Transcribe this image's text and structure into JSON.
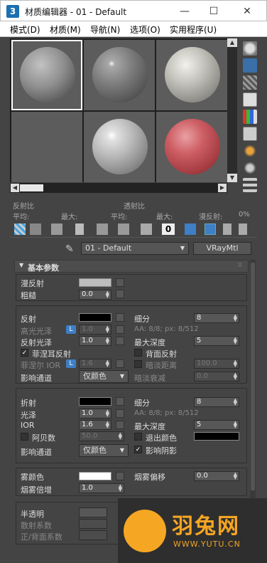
{
  "window": {
    "title": "材质编辑器 - 01 - Default",
    "app_icon": "3",
    "minimize": "—",
    "maximize": "☐",
    "close": "✕"
  },
  "menu": [
    "模式(D)",
    "材质(M)",
    "导航(N)",
    "选项(O)",
    "实用程序(U)"
  ],
  "slots": [
    {
      "name": "slot-1",
      "selected": true,
      "color": "#8a8a8a"
    },
    {
      "name": "slot-2",
      "selected": false,
      "color": "#7f7f7f"
    },
    {
      "name": "slot-3",
      "selected": false,
      "color": "#b9b8b3"
    },
    {
      "name": "slot-4",
      "selected": false,
      "color": ""
    },
    {
      "name": "slot-5",
      "selected": false,
      "color": "#bdbdbd"
    },
    {
      "name": "slot-6",
      "selected": false,
      "color": "#c0535a"
    }
  ],
  "stats": {
    "reflect_label": "反射比",
    "refract_label": "透射比",
    "avg1": "平均:",
    "max1": "最大:",
    "avg2": "平均:",
    "max2": "最大:",
    "diffuse": "漫反射:",
    "diffuse_val": "0%"
  },
  "toolbar_zero": "0",
  "material": {
    "name": "01 - Default",
    "type": "VRayMtl"
  },
  "rollout": {
    "title": "基本参数",
    "diffuse": "漫反射",
    "roughness": "粗糙",
    "roughness_val": "0.0",
    "reflect": "反射",
    "subdivs": "细分",
    "subdivs_val": "8",
    "hilight_gloss": "高光光泽",
    "hilight_gloss_val": "1.0",
    "aa1": "AA: 8/8; px: 8/512",
    "refl_gloss": "反射光泽",
    "refl_gloss_val": "1.0",
    "max_depth": "最大深度",
    "max_depth_val": "5",
    "fresnel": "菲涅耳反射",
    "back_reflect": "背面反射",
    "fresnel_ior": "菲涅尔 IOR",
    "fresnel_ior_val": "1.6",
    "dim_dist": "暗淡距离",
    "dim_dist_val": "100.0",
    "affect_ch": "影响通道",
    "color_only": "仅颜色",
    "dim_falloff": "暗淡衰减",
    "dim_falloff_val": "0.0",
    "refract": "折射",
    "subdivs2": "细分",
    "subdivs2_val": "8",
    "gloss": "光泽",
    "gloss_val": "1.0",
    "aa2": "AA: 8/8; px: 8/512",
    "ior": "IOR",
    "ior_val": "1.6",
    "max_depth2": "最大深度",
    "max_depth2_val": "5",
    "abbe": "阿贝数",
    "abbe_val": "50.0",
    "exit_color": "退出颜色",
    "affect_ch2": "影响通道",
    "color_only2": "仅颜色",
    "affect_shadows": "影响阴影",
    "fog_color": "雾颜色",
    "fog_bias": "烟雾偏移",
    "fog_bias_val": "0.0",
    "fog_mult": "烟雾倍增",
    "fog_mult_val": "1.0",
    "translucency": "半透明",
    "scatter": "散射系数",
    "front_back": "正/背面系数",
    "lbtn": "L"
  },
  "logo": {
    "text": "羽兔网",
    "url": "WWW.YUTU.CN"
  },
  "colors": {
    "bg": "#444444",
    "swatch_black": "#000000",
    "swatch_white": "#ffffff",
    "swatch_grey": "#bdbdbd",
    "accent": "#3e7fc5",
    "logo": "#f5a623"
  }
}
